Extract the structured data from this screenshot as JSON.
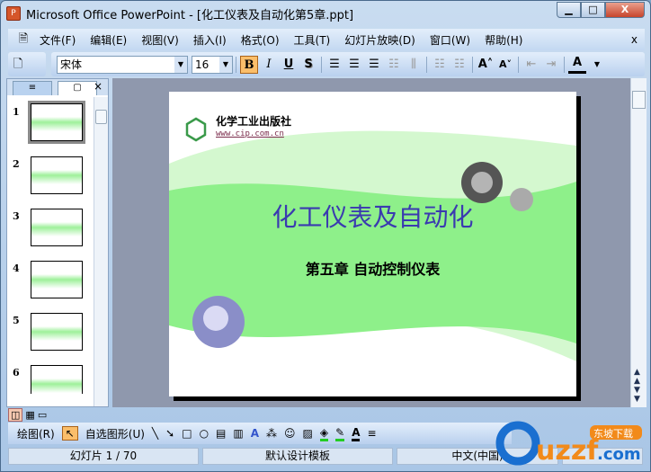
{
  "window": {
    "title": "Microsoft Office PowerPoint - [化工仪表及自动化第5章.ppt]",
    "minimize": "▁",
    "maximize": "□",
    "close": "X"
  },
  "menu": [
    "文件(F)",
    "编辑(E)",
    "视图(V)",
    "插入(I)",
    "格式(O)",
    "工具(T)",
    "幻灯片放映(D)",
    "窗口(W)",
    "帮助(H)"
  ],
  "menu_close": "x",
  "toolbar": {
    "font": "宋体",
    "size": "16",
    "bold": "B",
    "italic": "I",
    "underline": "U",
    "shadow": "S",
    "font_color": "A"
  },
  "pane": {
    "close": "×",
    "tab_outline": "≡",
    "tab_slides": "▢",
    "slide_numbers": [
      "1",
      "2",
      "3",
      "4",
      "5",
      "6"
    ]
  },
  "slide": {
    "publisher": "化学工业出版社",
    "url": "www.cip.com.cn",
    "title": "化工仪表及自动化",
    "subtitle": "第五章 自动控制仪表"
  },
  "drawing": {
    "draw": "绘图(R)",
    "autoshapes": "自选图形(U)"
  },
  "status": {
    "slide": "幻灯片 1 / 70",
    "template": "默认设计模板",
    "language": "中文(中国)"
  },
  "watermark": "uzzf.com 东坡下载"
}
